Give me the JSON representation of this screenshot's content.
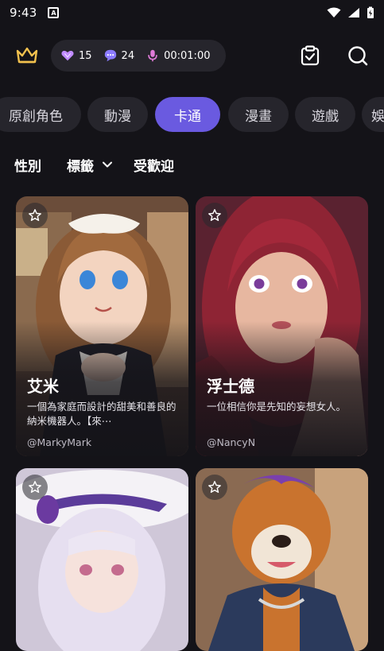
{
  "status_bar": {
    "time": "9:43",
    "notification_letter": "A"
  },
  "top_bar": {
    "gems": "15",
    "messages": "24",
    "voice_time": "00:01:00"
  },
  "tabs": [
    {
      "label": "原創角色",
      "active": false
    },
    {
      "label": "動漫",
      "active": false
    },
    {
      "label": "卡通",
      "active": true
    },
    {
      "label": "漫畫",
      "active": false
    },
    {
      "label": "遊戲",
      "active": false
    },
    {
      "label": "娛",
      "active": false
    }
  ],
  "filters": {
    "gender": "性別",
    "tags": "標籤",
    "popular": "受歡迎"
  },
  "cards": [
    {
      "name": "艾米",
      "description": "一個為家庭而設計的甜美和善良的納米機器人。【來⋯",
      "author": "@MarkyMark"
    },
    {
      "name": "浮士德",
      "description": "一位相信你是先知的妄想女人。",
      "author": "@NancyN"
    },
    {
      "name": "",
      "description": "",
      "author": ""
    },
    {
      "name": "",
      "description": "",
      "author": ""
    }
  ],
  "colors": {
    "accent": "#6a5ae0",
    "background": "#141318",
    "pill": "#26252c"
  }
}
